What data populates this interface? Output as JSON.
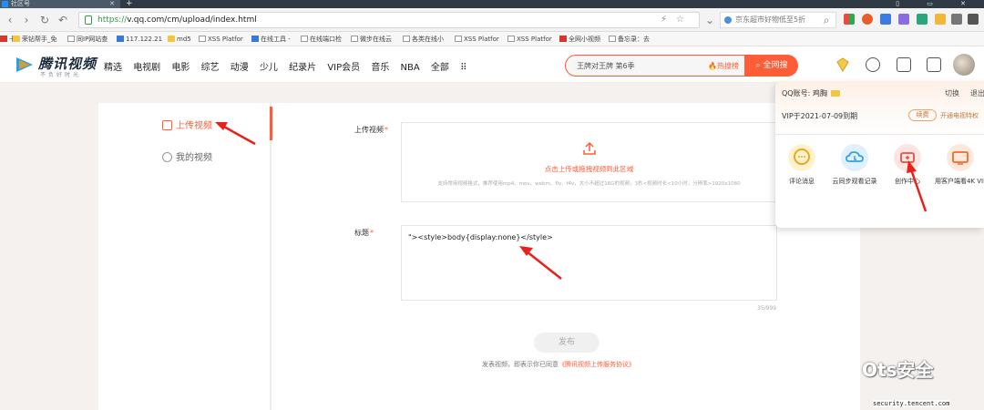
{
  "browser": {
    "tab_title": "社区号",
    "new_tab": "+",
    "url_scheme": "https://",
    "url_rest": "v.qq.com/cm/upload/index.html",
    "ad_text": "京东超市好物低至5折"
  },
  "bookmarks": [
    "荣钻帮手_免",
    "同IP网站查",
    "117.122.21",
    "md5",
    "XSS Platfor",
    "在线工具 -",
    "在线端口检",
    "微步在线云",
    "各类在线小",
    "XSS Platfor",
    "XSS Platfor",
    "全网小视频",
    "备忘录：去"
  ],
  "site": {
    "logo_text": "腾讯视频",
    "logo_sub": "不负好时光",
    "nav": [
      "精选",
      "电视剧",
      "电影",
      "综艺",
      "动漫",
      "少儿",
      "纪录片",
      "VIP会员",
      "音乐",
      "NBA",
      "全部"
    ],
    "search_placeholder": "王牌对王牌 第6季",
    "search_hot": "热搜榜",
    "search_button": "全网搜"
  },
  "sidebar": {
    "upload": "上传视频",
    "mine": "我的视频"
  },
  "form": {
    "upload_label": "上传视频",
    "upload_hint": "点击上传或拖拽视频到此区域",
    "upload_note": "支持常用视频格式，推荐使用mp4、mov、webm、flv、f4v，大小不超过16G的视频，3秒<视频时长<10小时，分辨率>1920x1080",
    "title_label": "标题",
    "title_value": "\"><style>body{display:none}</style>",
    "counter": "35/999",
    "publish": "发布",
    "agree_prefix": "发表视频，即表示你已同意",
    "agree_link": "《腾讯视频上传服务协议》"
  },
  "dropdown": {
    "qq_label": "QQ账号: 鸡胸",
    "switch": "切换",
    "logout": "退出",
    "vip_text": "VIP于2021-07-09到期",
    "renew": "续费",
    "open_vip": "开通电视特权",
    "items": [
      "评论消息",
      "云同步观看记录",
      "创作中心",
      "用客户端看4K VIP"
    ]
  },
  "watermark": {
    "brand": "Ots安全",
    "source": "security.tencent.com"
  }
}
